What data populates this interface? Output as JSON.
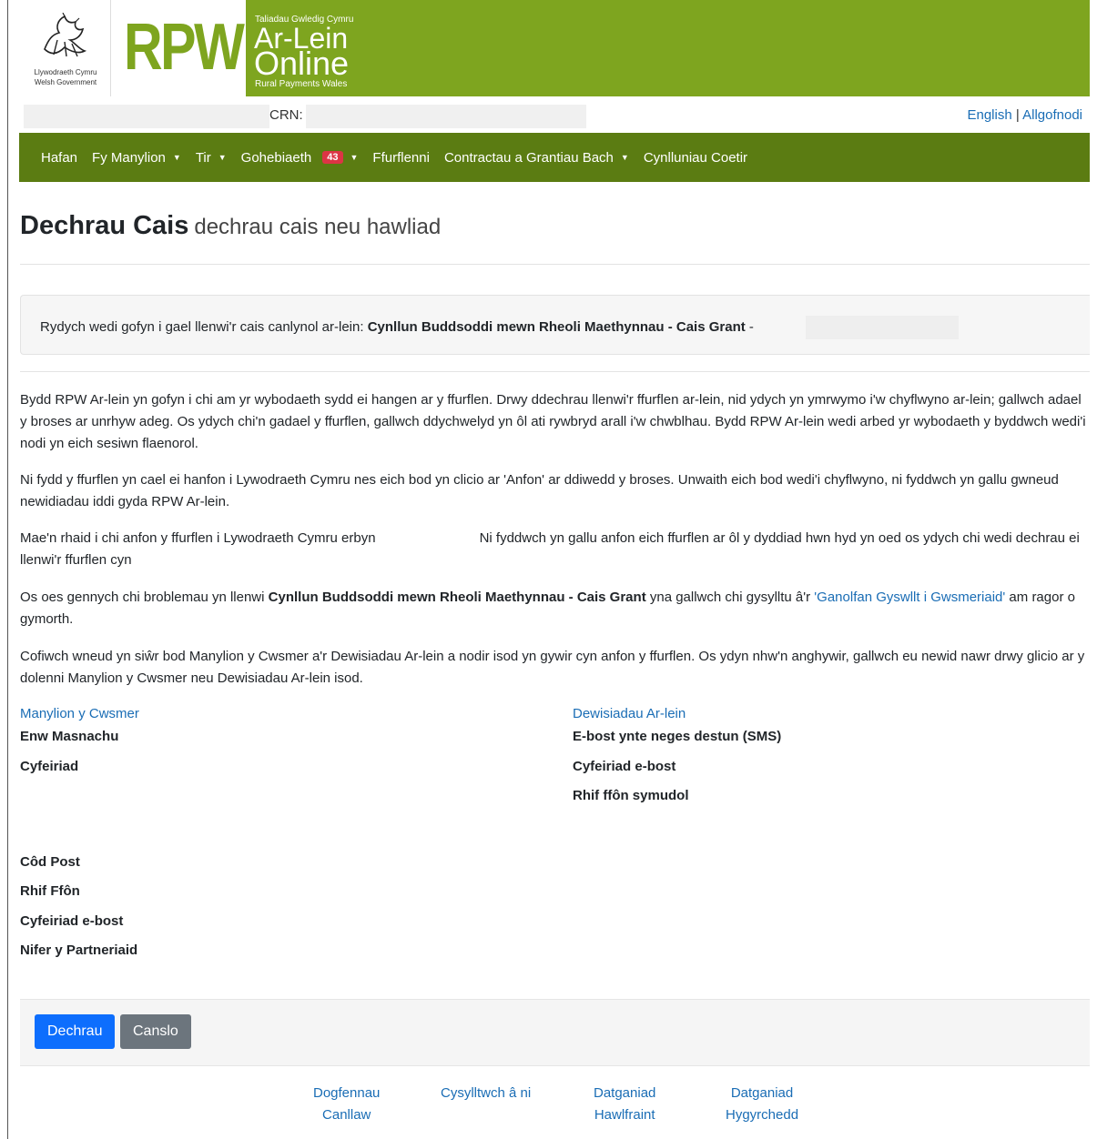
{
  "header": {
    "gov_line1": "Llywodraeth Cymru",
    "gov_line2": "Welsh Government",
    "rpw": "RPW",
    "small_top": "Taliadau Gwledig Cymru",
    "ar_lein": "Ar-Lein",
    "online": "Online",
    "rural": "Rural Payments Wales",
    "crn_label": "CRN:",
    "lang_english": "English",
    "lang_sep": "|",
    "logout": "Allgofnodi"
  },
  "nav": {
    "items": [
      {
        "label": "Hafan"
      },
      {
        "label": "Fy Manylion"
      },
      {
        "label": "Tir"
      },
      {
        "label": "Gohebiaeth"
      },
      {
        "label": "Ffurflenni"
      },
      {
        "label": "Contractau a Grantiau Bach"
      },
      {
        "label": "Cynlluniau Coetir"
      }
    ],
    "badge": "43"
  },
  "page": {
    "title": "Dechrau Cais",
    "subtitle": "dechrau cais neu hawliad",
    "alert_prefix": "Rydych wedi gofyn i gael llenwi'r cais canlynol ar-lein: ",
    "alert_bold": "Cynllun Buddsoddi mewn Rheoli Maethynnau - Cais Grant",
    "alert_suffix": " -",
    "para1": "Bydd RPW Ar-lein yn gofyn i chi am yr wybodaeth sydd ei hangen ar y ffurflen. Drwy ddechrau llenwi'r ffurflen ar-lein, nid ydych yn ymrwymo i'w chyflwyno ar-lein; gallwch adael y broses ar unrhyw adeg. Os ydych chi'n gadael y ffurflen, gallwch ddychwelyd yn ôl ati rywbryd arall i'w chwblhau. Bydd RPW Ar-lein wedi arbed yr wybodaeth y byddwch wedi'i nodi yn eich sesiwn flaenorol.",
    "para2": "Ni fydd y ffurflen yn cael ei hanfon i Lywodraeth Cymru nes eich bod yn clicio ar 'Anfon' ar ddiwedd y broses. Unwaith eich bod wedi'i chyflwyno, ni fyddwch yn gallu gwneud newidiadau iddi gyda RPW Ar-lein.",
    "para3a": "Mae'n rhaid i chi anfon y ffurflen i Lywodraeth Cymru erbyn",
    "para3b": "Ni fyddwch yn gallu anfon eich ffurflen ar ôl y dyddiad hwn hyd yn oed os ydych chi wedi dechrau ei llenwi'r ffurflen cyn",
    "para4a": "Os oes gennych chi broblemau yn llenwi ",
    "para4bold": "Cynllun Buddsoddi mewn Rheoli Maethynnau - Cais Grant",
    "para4b": " yna gallwch chi gysylltu â'r ",
    "para4link": "'Ganolfan Gyswllt i Gwsmeriaid'",
    "para4c": " am ragor o gymorth.",
    "para5": "Cofiwch wneud yn siŵr bod Manylion y Cwsmer a'r Dewisiadau Ar-lein a nodir isod yn gywir cyn anfon y ffurflen. Os ydyn nhw'n anghywir, gallwch eu newid nawr drwy glicio ar y dolenni Manylion y Cwsmer neu Dewisiadau Ar-lein isod."
  },
  "customer": {
    "heading": "Manylion y Cwsmer",
    "trading_name": "Enw Masnachu",
    "address": "Cyfeiriad",
    "postcode": "Côd Post",
    "phone": "Rhif Ffôn",
    "email": "Cyfeiriad e-bost",
    "partners": "Nifer y Partneriaid"
  },
  "preferences": {
    "heading": "Dewisiadau Ar-lein",
    "email_or_sms": "E-bost ynte neges destun (SMS)",
    "email": "Cyfeiriad e-bost",
    "mobile": "Rhif ffôn symudol"
  },
  "buttons": {
    "start": "Dechrau",
    "cancel": "Canslo"
  },
  "footer": {
    "guidance_1": "Dogfennau",
    "guidance_2": "Canllaw",
    "contact": "Cysylltwch â ni",
    "copyright_1": "Datganiad",
    "copyright_2": "Hawlfraint",
    "access_1": "Datganiad",
    "access_2": "Hygyrchedd"
  },
  "colors": {
    "banner_green": "#7ea51f",
    "nav_green": "#5b7c12",
    "link_blue": "#1a6db5",
    "primary": "#0d6efd",
    "secondary": "#6c757d",
    "badge": "#dc3545"
  }
}
